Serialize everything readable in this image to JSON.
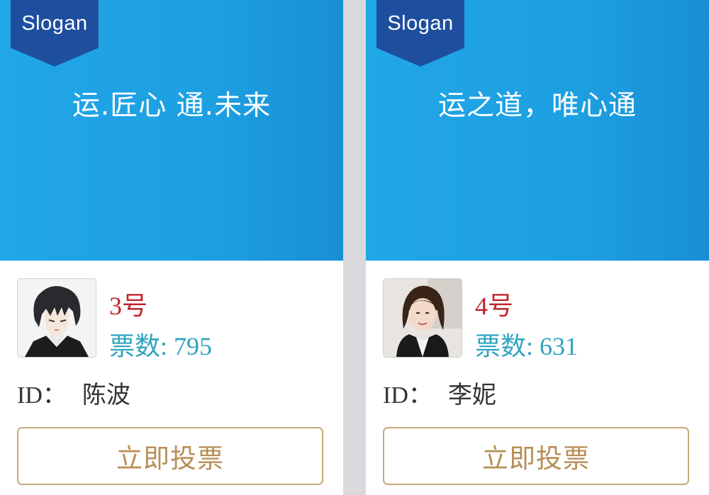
{
  "cards": [
    {
      "ribbon_label": "Slogan",
      "slogan": "运.匠心 通.未来",
      "number": "3号",
      "votes_label": "票数:",
      "votes": "795",
      "id_label": "ID：",
      "name": "陈波",
      "vote_button": "立即投票",
      "avatar": "anime-boy-avatar"
    },
    {
      "ribbon_label": "Slogan",
      "slogan": "运之道，唯心通",
      "number": "4号",
      "votes_label": "票数:",
      "votes": "631",
      "id_label": "ID：",
      "name": "李妮",
      "vote_button": "立即投票",
      "avatar": "woman-photo-avatar"
    }
  ],
  "colors": {
    "banner_blue": "#1da0e2",
    "ribbon_navy": "#1e4f9f",
    "number_red": "#c0252c",
    "votes_teal": "#2fa4bf",
    "button_gold": "#c8a978",
    "divider_gray": "#dad9de"
  }
}
